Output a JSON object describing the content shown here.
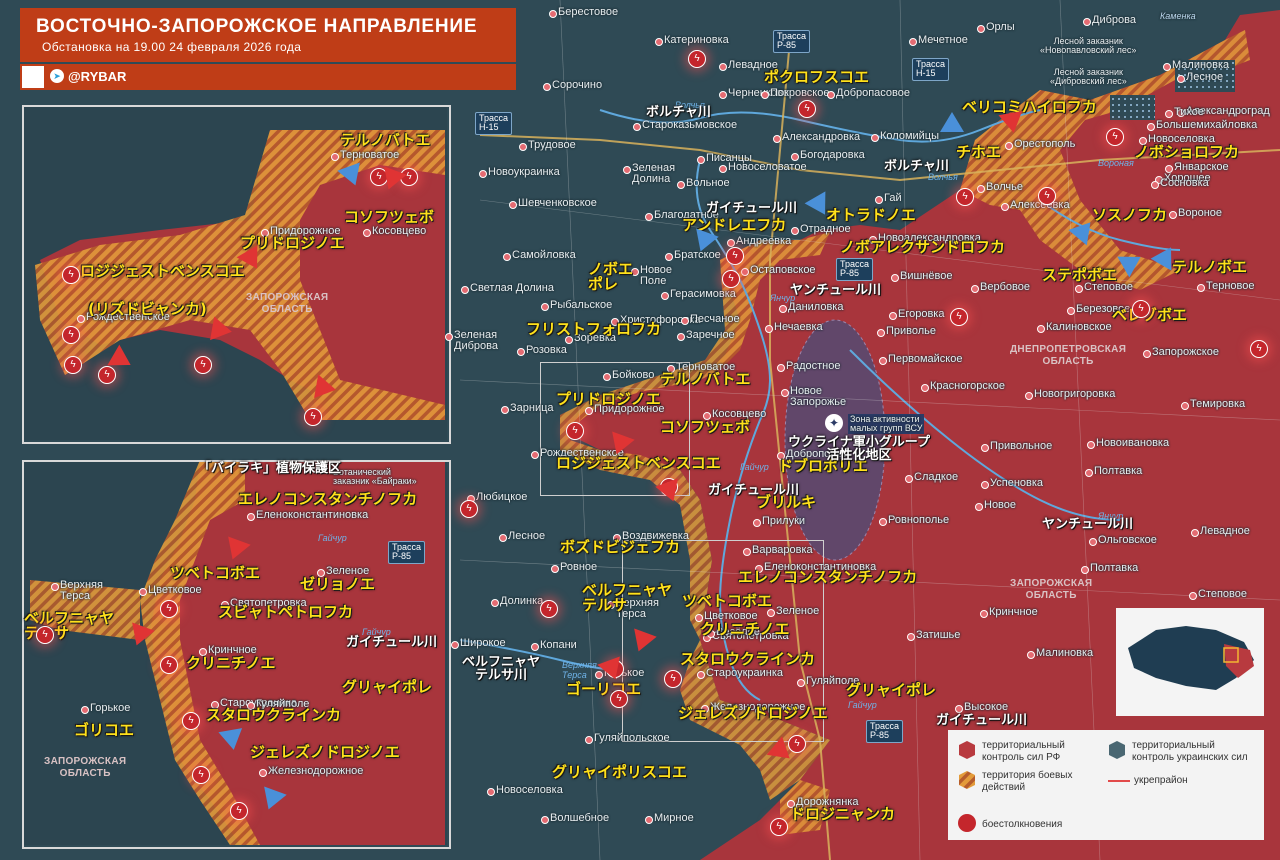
{
  "header": {
    "title": "ВОСТОЧНО-ЗАПОРОЖСКОЕ НАПРАВЛЕНИЕ",
    "subtitle": "Обстановка на 19.00 24 февраля 2026 года",
    "handle": "@RYBAR"
  },
  "colors": {
    "ru_control": "#b93a3f",
    "ua_control": "#2f4a55",
    "combat_zone": "#e59a3a",
    "accent": "#bf3d17",
    "jp_text": "#ffe11a"
  },
  "legend": {
    "ru": "территориальный контроль сил РФ",
    "ua": "территориальный контроль украинских сил",
    "combat": "территория боевых действий",
    "fort": "укрепрайон",
    "clash": "боестолкновения"
  },
  "highways": {
    "h15a": "Трасса\nН-15",
    "h15b": "Трасса\nН-15",
    "r85a": "Трасса\nР-85",
    "r85b": "Трасса\nР-85",
    "r85c": "Трасса\nР-85",
    "r85d": "Трасса\nР-85"
  },
  "regions": {
    "dnipro": "ДНЕПРОПЕТРОВСКАЯ\nОБЛАСТЬ",
    "zap_main": "ЗАПОРОЖСКАЯ\nОБЛАСТЬ",
    "zap_inset1": "ЗАПОРОЖСКАЯ\nОБЛАСТЬ",
    "zap_inset2": "ЗАПОРОЖСКАЯ\nОБЛАСТЬ"
  },
  "annotations": {
    "reserve1": "Лесной заказник\n«Новопавловский лес»",
    "reserve2": "Лесной заказник\n«Дибровский лес»",
    "reserve3": "Ботанический\nзаказник «Байраки»",
    "ua_group": "Зона активности\nмалых групп ВСУ",
    "kamenka": "Каменка"
  },
  "rivers": {
    "r1": "Волчья",
    "r2": "Волчья",
    "r3": "Вороная",
    "r4": "Янчур",
    "r5": "Янчур",
    "r6": "Гайчур",
    "r7": "Гайчур",
    "r8": "Гайчур",
    "r9": "Верхняя\nТерса",
    "r10": "Гайчур"
  },
  "jp_yellow": [
    "ポクロフスコエ",
    "ベリコミハイロフカ",
    "チホエ",
    "ノボショロフカ",
    "オトラドノエ",
    "ソスノフカ",
    "アンドレエフカ",
    "ノボアレクサンドロフカ",
    "ステポボエ",
    "テルノボエ",
    "ベレゾボエ",
    "ノボエ\nポレ",
    "フリストフォロフカ",
    "テルノバトエ",
    "プリドロジノエ",
    "コソフツェボ",
    "ロジジェストベンスコエ",
    "ドブロポリエ",
    "ブリルキ",
    "ボズドビジェフカ",
    "ベルフニャヤ\nテルサ",
    "エレノコンスタンチノフカ",
    "ツベトコボエ",
    "クリニチノエ",
    "スタロウクラインカ",
    "ゴーリコエ",
    "グリャイポレ",
    "ジェレズノドロジノエ",
    "グリャイポリスコエ",
    "ドロジニャンカ",
    "テルノバトエ",
    "コソフツェボ",
    "プリドロジノエ",
    "ロジジェストベンスコエ",
    "(リズドビャンカ)",
    "エレノコンスタンチノフカ",
    "ツベトコボエ",
    "ゼリョノエ",
    "スビャトペトロフカ",
    "ベルフニャヤ\nテルサ",
    "クリニチノエ",
    "スタロウクラインカ",
    "グリャイポレ",
    "ゴリコエ",
    "ジェレズノドロジノエ"
  ],
  "jp_white": [
    "ボルチャ川",
    "ボルチャ川",
    "ガイチュール川",
    "ヤンチュール川",
    "ウクライナ軍小グループ\n活性化地区",
    "ガイチュール川",
    "ヤンチュール川",
    "ベルフニャヤ\nテルサ川",
    "ガイチュール川",
    "ガイチュール川",
    "「バイラキ」植物保護区"
  ],
  "towns": [
    "Берестовое",
    "Катериновка",
    "Мечетное",
    "Орлы",
    "Диброва",
    "Сорочино",
    "Левадное",
    "Черненково",
    "Покровское",
    "Добропасовое",
    "Малиновка",
    "Лесное",
    "Александроград",
    "Тихое",
    "Большемихайловка",
    "Трудовое",
    "Староказьмовское",
    "Александровка",
    "Коломийцы",
    "Орестополь",
    "Новоселовка",
    "Январское",
    "Писанцы",
    "Богодаровка",
    "Хорошее",
    "Сосновка",
    "Вороное",
    "Новоукраинка",
    "Зеленая\nДолина",
    "Вольное",
    "Новоселоватое",
    "Гай",
    "Волчье",
    "Алексеевка",
    "Шевченковское",
    "Благодатное",
    "Андреевка",
    "Отрадное",
    "Новоалександровка",
    "Самойловка",
    "Братское",
    "Новое\nПоле",
    "Остаповское",
    "Вишнёвое",
    "Вербовое",
    "Степовое",
    "Терновое",
    "Светлая Долина",
    "Рыбальское",
    "Герасимовка",
    "Даниловка",
    "Егоровка",
    "Березовое",
    "Христофоровка",
    "Песчаное",
    "Нечаевка",
    "Приволье",
    "Калиновское",
    "Зеленая\nДиброва",
    "Розовка",
    "Зоревка",
    "Заречное",
    "Радостное",
    "Первомайское",
    "Запорожское",
    "Терноватое",
    "Бойково",
    "Новое\nЗапорожье",
    "Новогригоровка",
    "Красногорское",
    "Темировка",
    "Зарница",
    "Придорожное",
    "Косовцево",
    "Рождественское",
    "Доброполье",
    "Привольное",
    "Новоивановка",
    "Любицкое",
    "Полтавка",
    "Сладкое",
    "Прилуки",
    "Успеновка",
    "Новое",
    "Ровнополье",
    "Лесное",
    "Воздвижевка",
    "Варваровка",
    "Ровное",
    "Еленоконстантиновка",
    "Зеленое",
    "Долинка",
    "Верхняя\nТерса",
    "Цветковое",
    "Ольговское",
    "Полтавка",
    "Левадное",
    "Степовое",
    "Святопетровка",
    "Кринчное",
    "Весёлое",
    "Копани",
    "Затишье",
    "Широкое",
    "Горькое",
    "Староукраинка",
    "Гуляйполе",
    "Малиновка",
    "Железнодорожное",
    "Высокое",
    "Гуляйпольское",
    "Новоселовка",
    "Дорожнянка",
    "Волшебное",
    "Мирное"
  ],
  "inset1_towns": [
    "Терноватое",
    "Придорожное",
    "Косовцево",
    "Рождественское"
  ],
  "inset2_towns": [
    "Еленоконстантиновка",
    "Зеленое",
    "Верхняя\nТерса",
    "Цветковое",
    "Святопетровка",
    "Кринчное",
    "Староукраинка",
    "Гуляйполе",
    "Горькое",
    "Железнодорожное"
  ]
}
